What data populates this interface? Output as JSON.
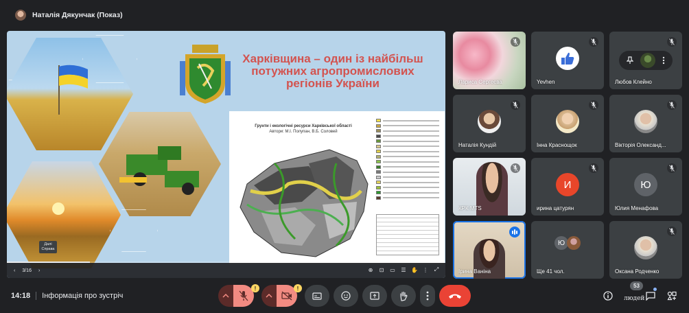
{
  "header": {
    "presenter_title": "Наталія Дякунчак (Показ)"
  },
  "slide": {
    "title": "Харківщина – один із найбільш потужних агропромислових регіонів України",
    "map_heading": "Грунти і екологічні ресурси Харківської області",
    "map_authors": "Автори: М.І. Полупан, В.Б. Соловей",
    "page_indicator": "3/16",
    "tooltip_next": "Далі",
    "tooltip_shortcut": "Справа",
    "progress_fraction": 0.19,
    "accent_title_color": "#d3534f",
    "legend_colors": [
      "#f3e04a",
      "#c9a845",
      "#9a8f5c",
      "#4a4a4a",
      "#6a9a3a",
      "#d9c98a",
      "#e1d04a",
      "#b0b070",
      "#8bc34a",
      "#3b7d2a",
      "#7a7a7a",
      "#c8c8c8",
      "#e5d35a",
      "#9bbf3a",
      "#2f9a2f",
      "#5a3a2a"
    ]
  },
  "participants": [
    {
      "name": "Лариса Сергеєва",
      "muted": true,
      "kind": "photo-flower"
    },
    {
      "name": "Yevhen",
      "muted": true,
      "kind": "thumbs-up"
    },
    {
      "name": "Любов Клейно",
      "muted": true,
      "kind": "hover"
    },
    {
      "name": "Наталія Кундій",
      "muted": true,
      "kind": "photo"
    },
    {
      "name": "Інна Краснощок",
      "muted": true,
      "kind": "photo"
    },
    {
      "name": "Вікторія Олександ...",
      "muted": true,
      "kind": "photo"
    },
    {
      "name": "КРК МTS",
      "muted": true,
      "kind": "video"
    },
    {
      "name": "ирина цатурян",
      "muted": true,
      "kind": "letter",
      "letter": "И",
      "color": "#e8462a"
    },
    {
      "name": "Юлия Менафова",
      "muted": true,
      "kind": "letter",
      "letter": "Ю",
      "color": "#5f6368"
    },
    {
      "name": "Ірина Ваніна",
      "muted": false,
      "kind": "video-speaking"
    },
    {
      "name": "Ще 41 чол.",
      "muted": false,
      "kind": "more",
      "letter": "Ю"
    },
    {
      "name": "Оксана Родченко",
      "muted": true,
      "kind": "photo"
    }
  ],
  "bottom": {
    "time": "14:18",
    "meeting_info": "Інформація про зустріч",
    "warning_mark": "!",
    "people_count": "53",
    "people_label": "людей"
  },
  "colors": {
    "end_call": "#ea4335",
    "mic_off": "#f28b82",
    "speaking": "#1a73e8"
  }
}
